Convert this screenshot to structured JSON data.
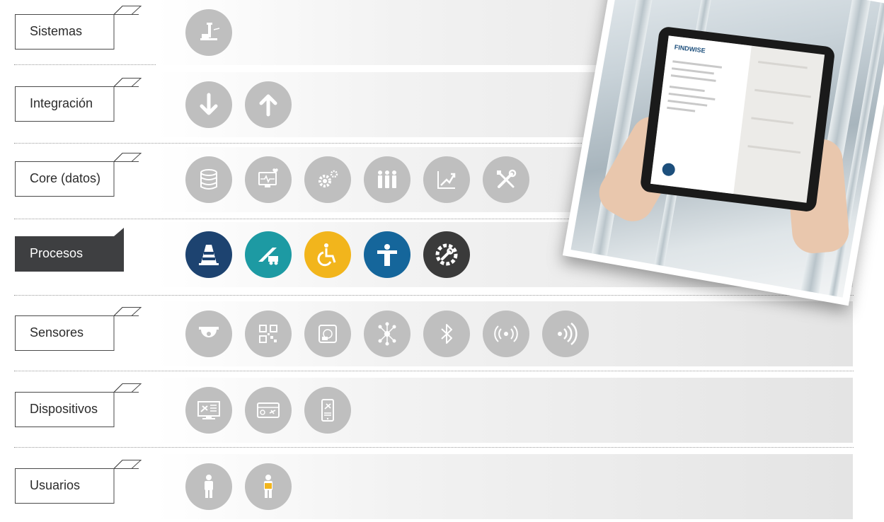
{
  "rows": [
    {
      "label": "Sistemas",
      "active": false,
      "icons": [
        "control-tower-icon"
      ]
    },
    {
      "label": "Integración",
      "active": false,
      "icons": [
        "arrow-down-icon",
        "arrow-up-icon"
      ]
    },
    {
      "label": "Core (datos)",
      "active": false,
      "icons": [
        "database-icon",
        "monitor-heart-icon",
        "gears-icon",
        "people-icon",
        "trend-chart-icon",
        "tools-icon"
      ]
    },
    {
      "label": "Procesos",
      "active": true,
      "icons": [
        "traffic-cone-icon",
        "boarding-stairs-icon",
        "wheelchair-icon",
        "marshaller-icon",
        "wrench-gear-icon"
      ]
    },
    {
      "label": "Sensores",
      "active": false,
      "icons": [
        "dome-camera-icon",
        "qr-code-icon",
        "rfid-tag-icon",
        "network-hub-icon",
        "bluetooth-icon",
        "broadcast-icon",
        "nfc-signal-icon"
      ]
    },
    {
      "label": "Dispositivos",
      "active": false,
      "icons": [
        "flight-display-icon",
        "boarding-pass-icon",
        "mobile-flight-icon"
      ]
    },
    {
      "label": "Usuarios",
      "active": false,
      "icons": [
        "passenger-icon",
        "staff-vest-icon"
      ]
    }
  ],
  "colors": {
    "inactive_icon": "#bfbfbf",
    "active_label_bg": "#3e3f41",
    "process_icons": [
      "#1d4370",
      "#1d9aa3",
      "#f2b51c",
      "#15669b",
      "#3a3a3a"
    ]
  },
  "tablet_app": {
    "logo_text": "FINDWISE"
  }
}
